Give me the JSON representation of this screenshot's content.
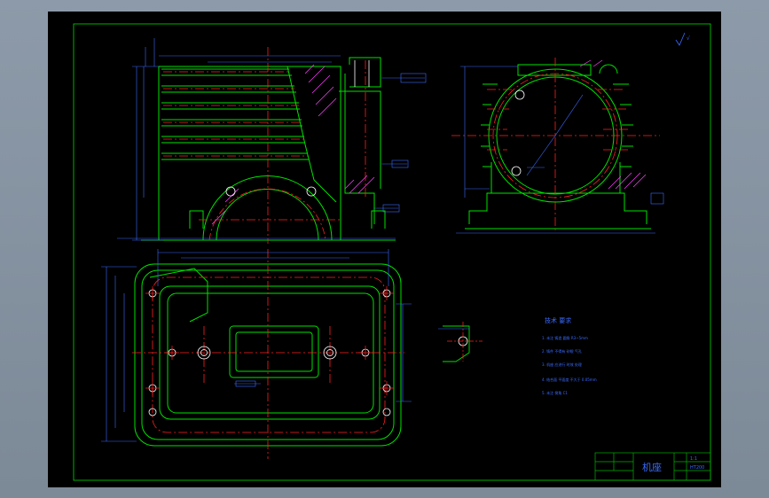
{
  "colors": {
    "background": "#000000",
    "border": "#00b000",
    "outline": "#00e000",
    "center_line": "#ff2020",
    "dimension": "#3b6bff",
    "hatch": "#ff40ff",
    "detail": "#ffffff"
  },
  "tech_notes": {
    "heading": "技术 要求",
    "items": [
      "1. 未注 铸造 圆角 R3~5mm",
      "2. 铸件 不得有 砂眼 气孔",
      "3. 机座 应进行 时效 处理",
      "4. 结合面 平面度 不大于 0.05mm",
      "5. 未注 倒角 C1"
    ]
  },
  "title_block": {
    "title": "机座",
    "scale": "1:1",
    "material": "HT200"
  },
  "surface_symbol": "√"
}
